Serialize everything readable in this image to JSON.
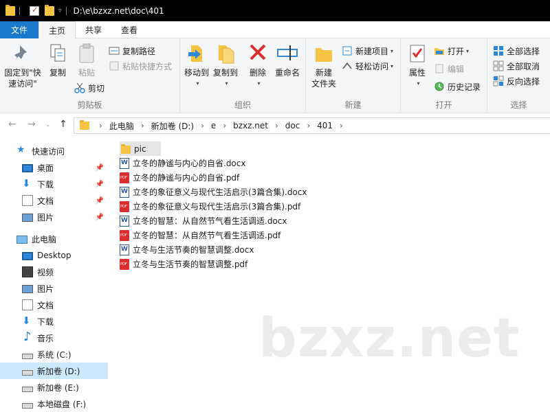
{
  "titlebar": {
    "path": "D:\\e\\bzxz.net\\doc\\401"
  },
  "tabs": {
    "file": "文件",
    "home": "主页",
    "share": "共享",
    "view": "查看"
  },
  "ribbon": {
    "clipboard": {
      "label": "剪贴板",
      "pin_quick": "固定到\"快速访问\"",
      "copy": "复制",
      "paste": "粘贴",
      "copy_path": "复制路径",
      "paste_shortcut": "粘贴快捷方式",
      "cut": "剪切"
    },
    "organize": {
      "label": "组织",
      "move_to": "移动到",
      "copy_to": "复制到",
      "delete": "删除",
      "rename": "重命名"
    },
    "new": {
      "label": "新建",
      "new_folder": "新建\n文件夹",
      "new_item": "新建项目",
      "easy_access": "轻松访问"
    },
    "open": {
      "label": "打开",
      "properties": "属性",
      "open": "打开",
      "edit": "编辑",
      "history": "历史记录"
    },
    "select": {
      "label": "选择",
      "select_all": "全部选择",
      "select_none": "全部取消",
      "invert": "反向选择"
    }
  },
  "address": {
    "crumbs": [
      "此电脑",
      "新加卷 (D:)",
      "e",
      "bzxz.net",
      "doc",
      "401"
    ]
  },
  "nav": {
    "quick_access": "快速访问",
    "quick_items": [
      "桌面",
      "下载",
      "文档",
      "图片"
    ],
    "this_pc": "此电脑",
    "pc_items": [
      "Desktop",
      "视频",
      "图片",
      "文档",
      "下载",
      "音乐",
      "系统 (C:)",
      "新加卷 (D:)",
      "新加卷 (E:)",
      "本地磁盘 (F:)"
    ]
  },
  "files": [
    {
      "name": "pic",
      "type": "folder"
    },
    {
      "name": "立冬的静谧与内心的自省.docx",
      "type": "docx"
    },
    {
      "name": "立冬的静谧与内心的自省.pdf",
      "type": "pdf"
    },
    {
      "name": "立冬的象征意义与现代生活启示(3篇合集).docx",
      "type": "docx"
    },
    {
      "name": "立冬的象征意义与现代生活启示(3篇合集).pdf",
      "type": "pdf"
    },
    {
      "name": "立冬的智慧：从自然节气看生活调适.docx",
      "type": "docx"
    },
    {
      "name": "立冬的智慧：从自然节气看生活调适.pdf",
      "type": "pdf"
    },
    {
      "name": "立冬与生活节奏的智慧调整.docx",
      "type": "docx"
    },
    {
      "name": "立冬与生活节奏的智慧调整.pdf",
      "type": "pdf"
    }
  ],
  "watermark": "bzxz.net"
}
